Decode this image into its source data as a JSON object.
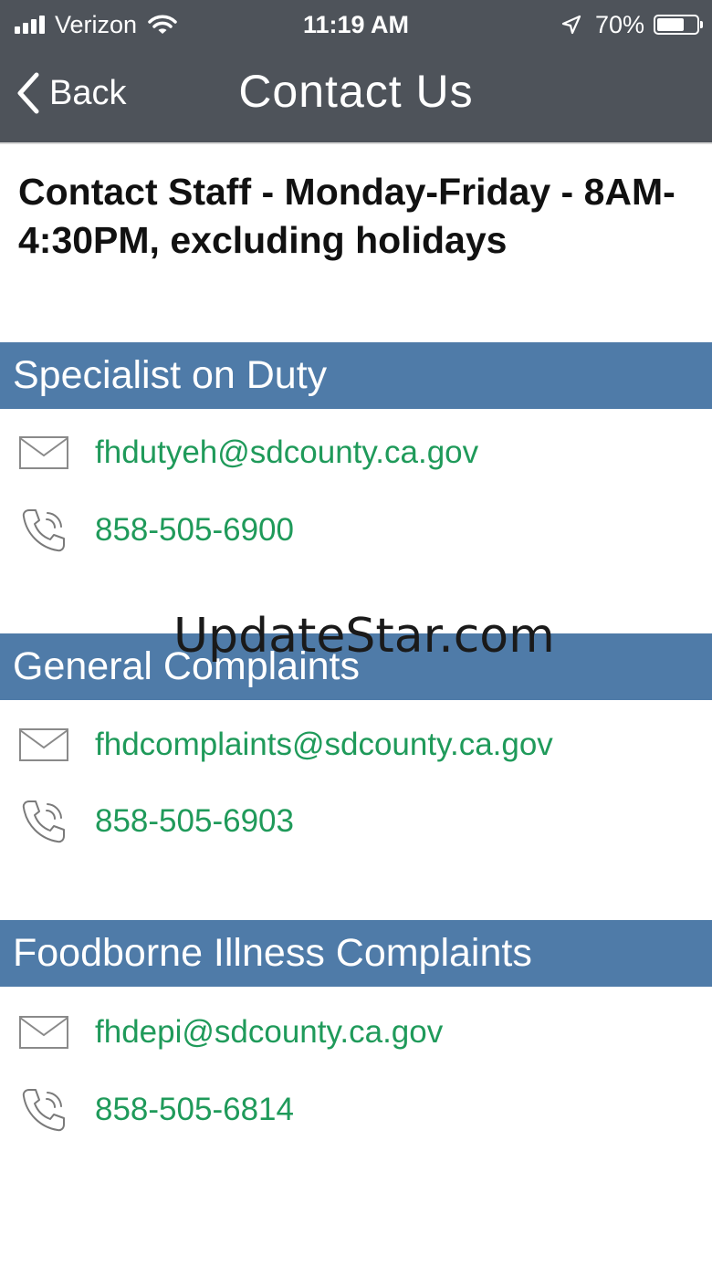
{
  "status_bar": {
    "carrier": "Verizon",
    "time": "11:19 AM",
    "battery_percent": "70%",
    "battery_level": 0.7,
    "icons": [
      "signal-icon",
      "wifi-icon",
      "location-arrow-icon",
      "battery-icon"
    ]
  },
  "nav": {
    "back_label": "Back",
    "title": "Contact Us"
  },
  "intro_text": "Contact Staff - Monday-Friday - 8AM-4:30PM, excluding holidays",
  "sections": [
    {
      "title": "Specialist on Duty",
      "email": "fhdutyeh@sdcounty.ca.gov",
      "phone": "858-505-6900"
    },
    {
      "title": "General Complaints",
      "email": "fhdcomplaints@sdcounty.ca.gov",
      "phone": "858-505-6903"
    },
    {
      "title": "Foodborne Illness Complaints",
      "email": "fhdepi@sdcounty.ca.gov",
      "phone": "858-505-6814"
    }
  ],
  "watermark": "UpdateStar.com",
  "colors": {
    "header_bg": "#4e535a",
    "section_bg": "#4f7ba8",
    "link": "#1f9a5a",
    "icon": "#7a7a7a"
  }
}
